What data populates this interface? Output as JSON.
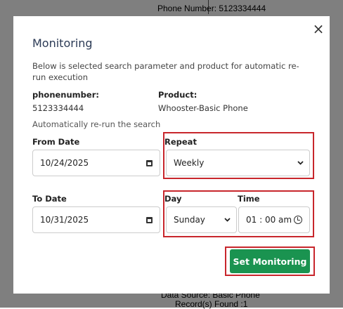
{
  "background": {
    "phone_number": "Phone Number: 5123334444",
    "data_source": "Data Source: Basic Phone",
    "records_found": "Record(s) Found :1"
  },
  "modal": {
    "title": "Monitoring",
    "close_icon": "×",
    "description": "Below is selected search parameter and product for automatic re-run execution",
    "phonenumber_label": "phonenumber:",
    "phonenumber_value": "5123334444",
    "product_label": "Product:",
    "product_value": "Whooster-Basic Phone",
    "auto_rerun_text": "Automatically re-run the search",
    "from_date_label": "From Date",
    "from_date_value": "10/24/2025",
    "repeat_label": "Repeat",
    "repeat_value": "Weekly",
    "to_date_label": "To Date",
    "to_date_value": "10/31/2025",
    "day_label": "Day",
    "day_value": "Sunday",
    "time_label": "Time",
    "time_value": "01 : 00 am",
    "submit_label": "Set Monitoring"
  },
  "colors": {
    "primary_button": "#1a9350",
    "highlight_border": "#c8262c",
    "title": "#2b3a55"
  },
  "icons": [
    "close-icon",
    "calendar-icon",
    "chevron-down-icon",
    "clock-icon"
  ]
}
